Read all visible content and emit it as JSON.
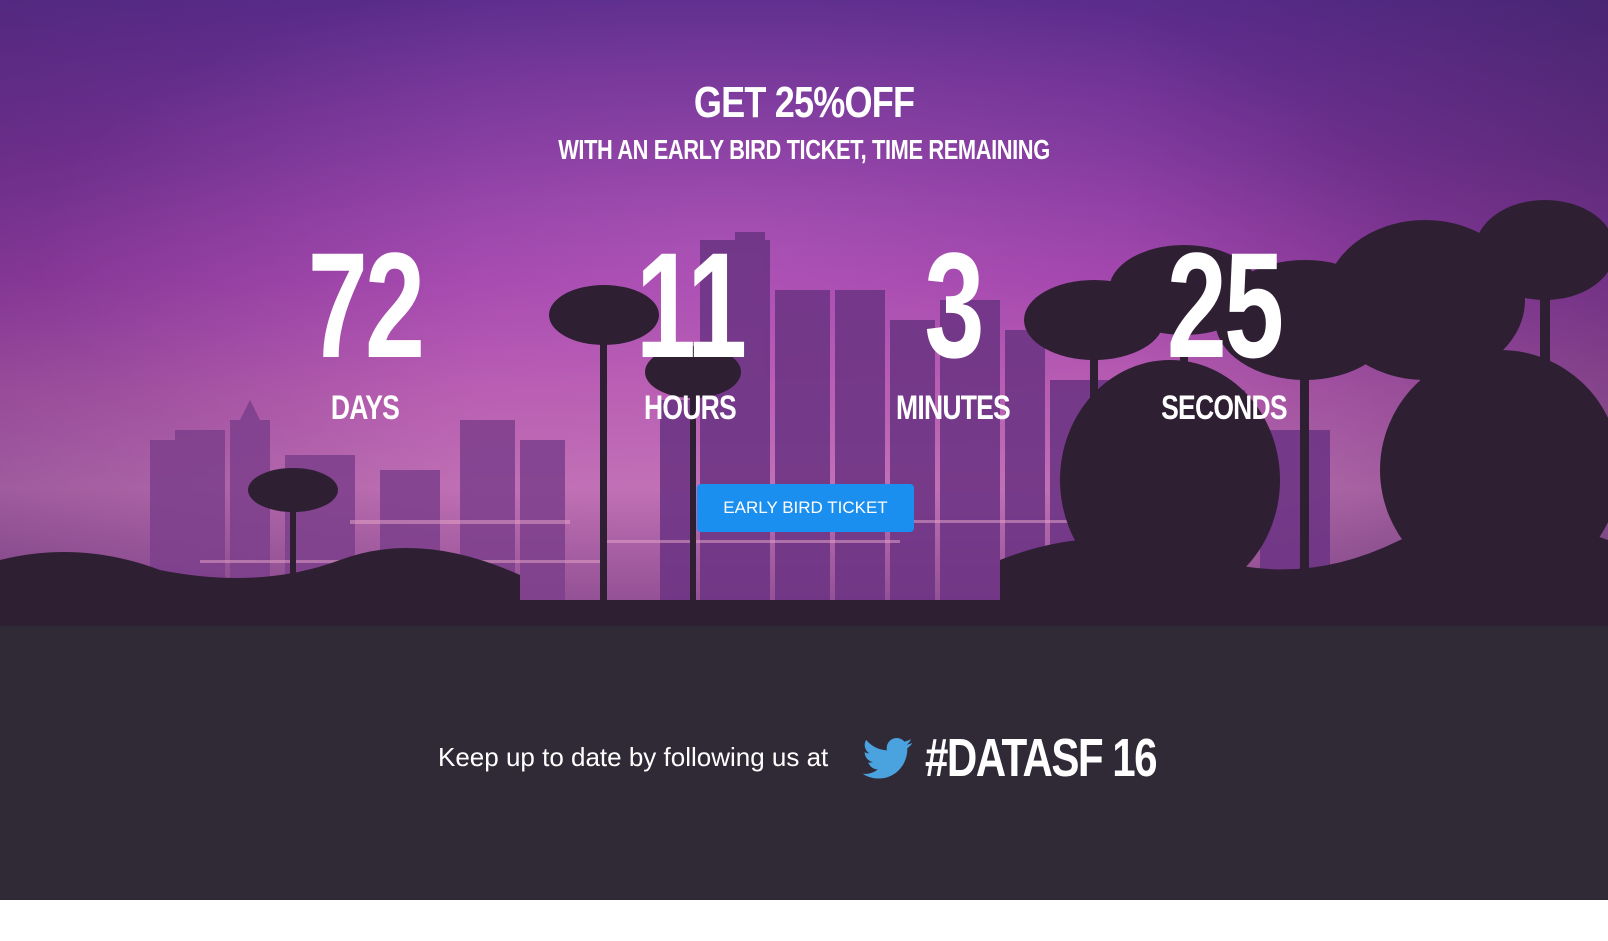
{
  "hero": {
    "headline": "GET 25%OFF",
    "subline": "WITH AN EARLY BIRD  TICKET, TIME REMAINING"
  },
  "countdown": {
    "days": {
      "value": "72",
      "label": "DAYS"
    },
    "hours": {
      "value": "11",
      "label": "HOURS"
    },
    "minutes": {
      "value": "3",
      "label": "MINUTES"
    },
    "seconds": {
      "value": "25",
      "label": "SECONDS"
    }
  },
  "cta": {
    "label": "EARLY BIRD TICKET"
  },
  "footer": {
    "follow_text": "Keep up to date by following us at",
    "hashtag": "#DATASF 16",
    "icon": "twitter-icon"
  },
  "colors": {
    "cta_background": "#1a8ff0",
    "footer_background": "#302a37",
    "twitter_blue": "#4aa3df"
  }
}
